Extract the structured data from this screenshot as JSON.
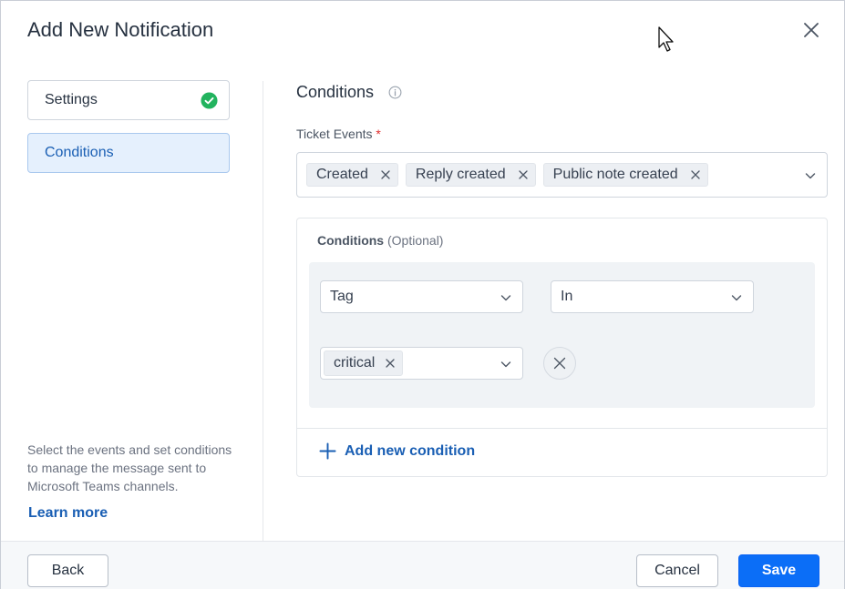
{
  "dialog": {
    "title": "Add New Notification"
  },
  "sidebar": {
    "items": [
      {
        "label": "Settings",
        "status": "complete"
      },
      {
        "label": "Conditions",
        "status": "active"
      }
    ],
    "help_text": "Select the events and set conditions to manage the message sent to Microsoft Teams channels.",
    "learn_more": "Learn more"
  },
  "main": {
    "section_title": "Conditions",
    "ticket_events": {
      "label": "Ticket Events",
      "required_marker": "*",
      "selected": [
        "Created",
        "Reply created",
        "Public note created"
      ]
    },
    "conditions": {
      "label": "Conditions",
      "optional": "(Optional)",
      "rows": [
        {
          "field": "Tag",
          "operator": "In",
          "values": [
            "critical"
          ]
        }
      ],
      "add_label": "Add new condition"
    }
  },
  "footer": {
    "back": "Back",
    "cancel": "Cancel",
    "save": "Save"
  },
  "colors": {
    "accent": "#0b6ef7",
    "link": "#1a5fb4",
    "success": "#22b35e",
    "required": "#e02d2d",
    "active_nav_bg": "#e5f0fd"
  }
}
